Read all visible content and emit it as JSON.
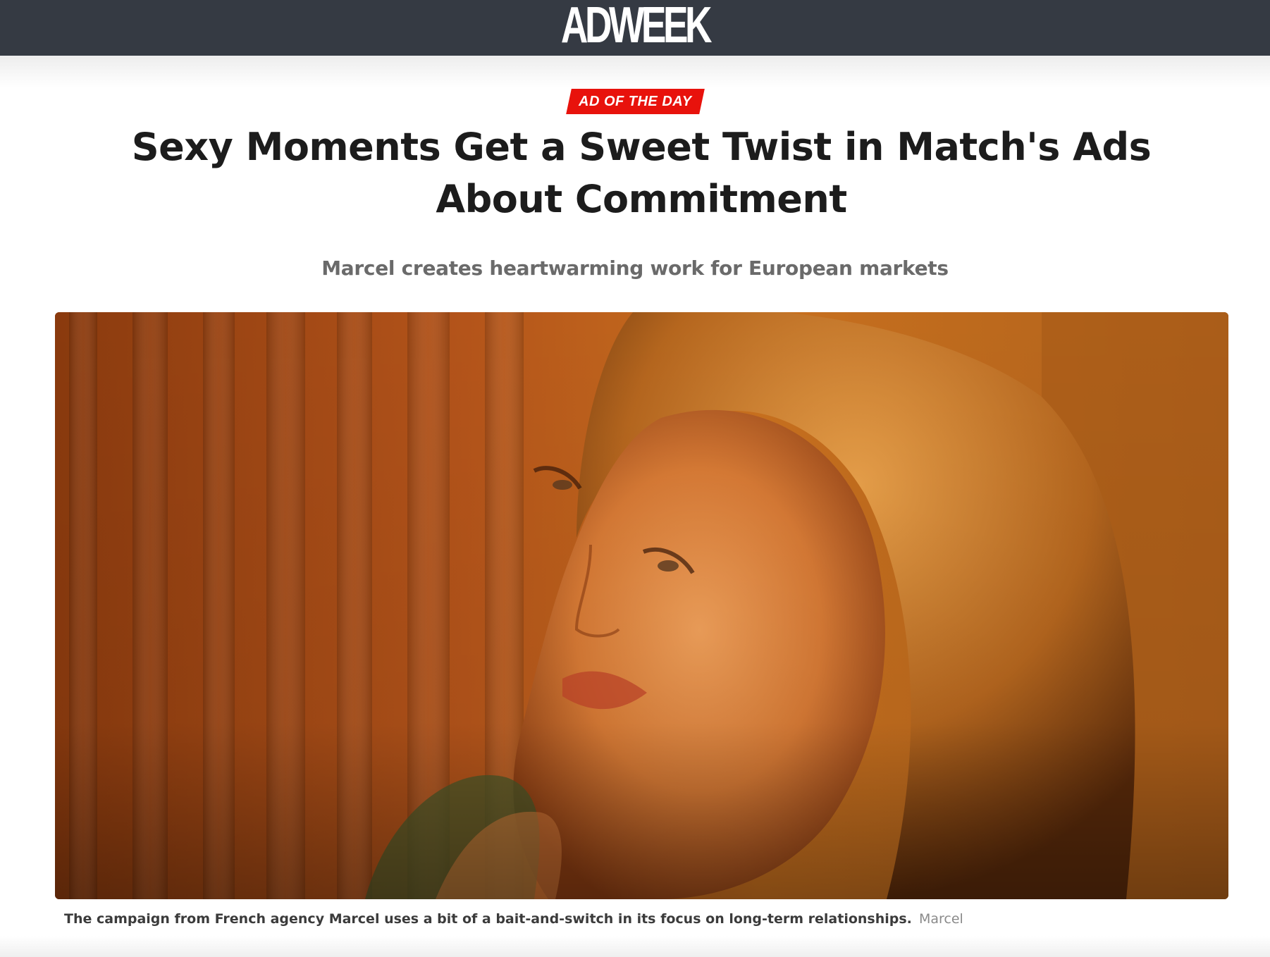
{
  "site": {
    "logo": "ADWEEK"
  },
  "article": {
    "category": "AD OF THE DAY",
    "headline": "Sexy Moments Get a Sweet Twist in Match's Ads About Commitment",
    "dek": "Marcel creates heartwarming work for European markets"
  },
  "hero": {
    "caption": "The campaign from French agency Marcel uses a bit of a bait-and-switch in its focus on long-term relationships.",
    "credit": "Marcel"
  },
  "colors": {
    "topbar": "#353a43",
    "badge": "#e8120c",
    "headline": "#1c1c1c",
    "dek": "#6a6a6a"
  }
}
